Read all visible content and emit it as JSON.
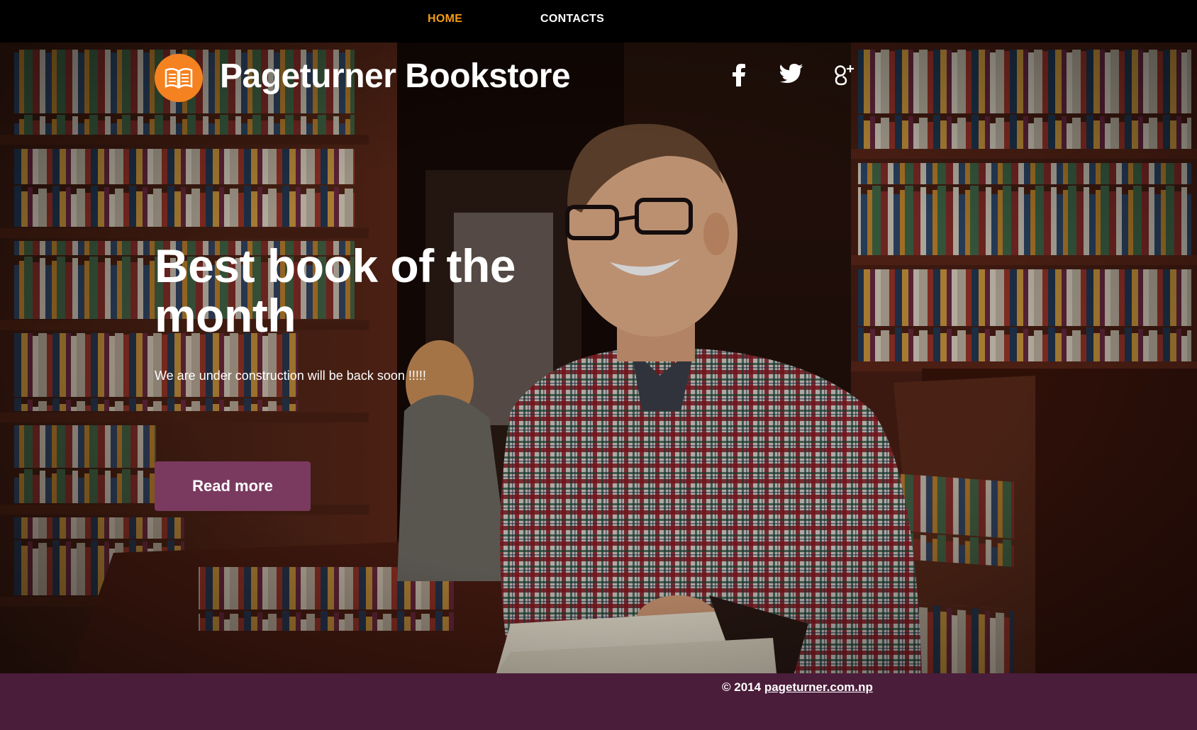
{
  "nav": {
    "items": [
      {
        "label": "HOME",
        "active": true
      },
      {
        "label": "CONTACTS",
        "active": false
      }
    ],
    "active_color": "#f39c12"
  },
  "header": {
    "site_title": "Pageturner Bookstore",
    "logo_icon": "open-book-icon",
    "logo_color": "#f58220",
    "social": [
      {
        "icon": "facebook-icon"
      },
      {
        "icon": "twitter-icon"
      },
      {
        "icon": "google-plus-icon"
      }
    ]
  },
  "hero": {
    "headline": "Best book of the month",
    "subtext": "We are under construction will be back soon !!!!!",
    "cta_label": "Read more",
    "cta_color": "#7a3a5f"
  },
  "footer": {
    "copyright": "© 2014",
    "link_text": "pageturner.com.np",
    "background": "#4a1d3a"
  }
}
